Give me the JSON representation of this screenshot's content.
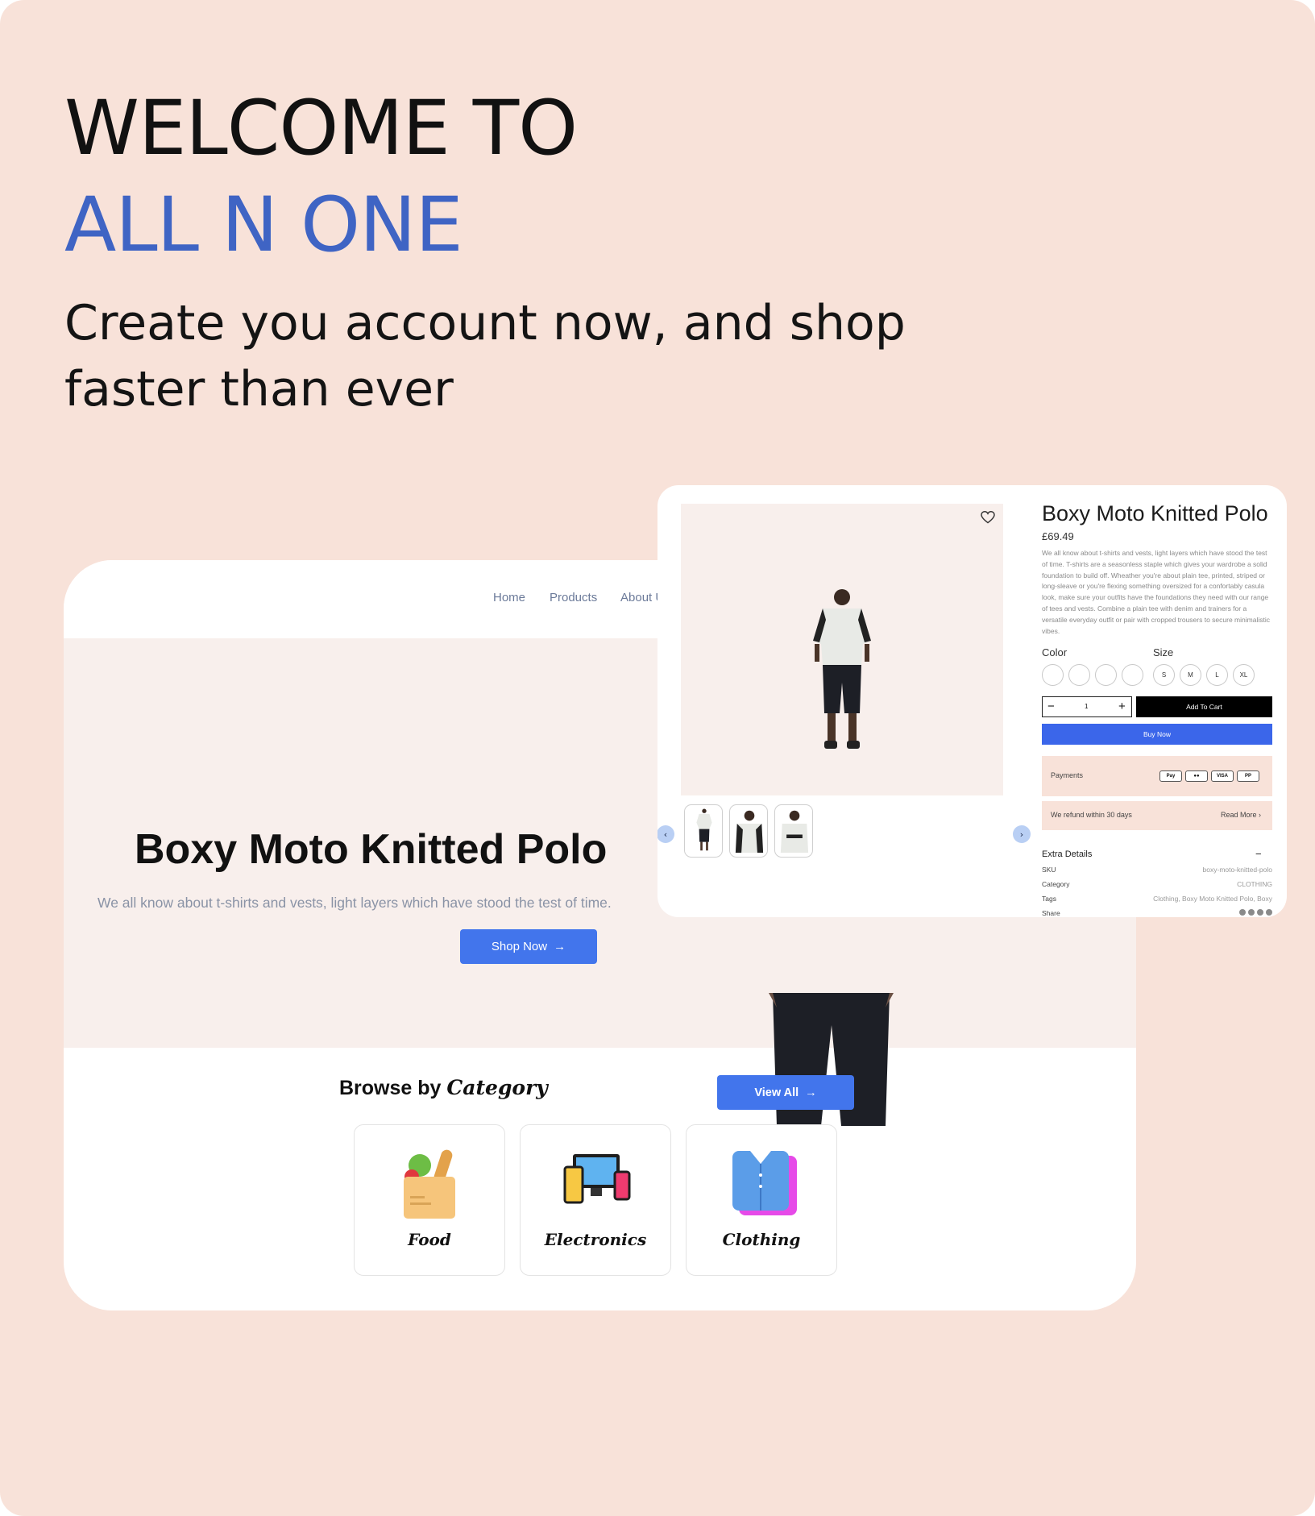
{
  "headline": {
    "line1": "WELCOME TO",
    "line2": "ALL N ONE",
    "tagline": "Create you account now, and shop faster than ever"
  },
  "home": {
    "nav": [
      "Home",
      "Products",
      "About U"
    ],
    "hero": {
      "title": "Boxy Moto Knitted Polo",
      "description": "We all know about t-shirts and vests, light layers which have stood the test of time.",
      "cta": "Shop Now"
    },
    "browse": {
      "title_plain": "Browse by",
      "title_accent": "Category",
      "view_all": "View All"
    },
    "categories": [
      {
        "label": "Food",
        "icon": "grocery-bag-icon"
      },
      {
        "label": "Electronics",
        "icon": "devices-icon"
      },
      {
        "label": "Clothing",
        "icon": "shirt-icon"
      }
    ]
  },
  "product": {
    "title": "Boxy Moto Knitted Polo",
    "price": "£69.49",
    "description": "We all know about t-shirts and vests, light layers which have stood the test of time. T-shirts are a seasonless staple which gives your wardrobe a solid foundation to build off. Wheather you're about plain tee, printed, striped or long-sleave or you're flexing something oversized for a confortably casula look, make sure your outfits have the foundations they need with our range of tees and vests. Combine a plain tee with denim and trainers for a versatile everyday outfit or pair with cropped trousers to secure minimalistic vibes.",
    "color_label": "Color",
    "size_label": "Size",
    "sizes": [
      "S",
      "M",
      "L",
      "XL"
    ],
    "quantity": "1",
    "add_to_cart": "Add To Cart",
    "buy_now": "Buy Now",
    "payments_label": "Payments",
    "payment_methods": [
      "Apple Pay",
      "Mastercard",
      "VISA",
      "PayPal"
    ],
    "refund_text": "We refund within 30 days",
    "read_more": "Read More",
    "extra_title": "Extra Details",
    "extra": {
      "sku_label": "SKU",
      "sku": "boxy-moto-knitted-polo",
      "category_label": "Category",
      "category": "CLOTHING",
      "tags_label": "Tags",
      "tags": "Clothing, Boxy Moto Knitted Polo, Boxy",
      "share_label": "Share"
    }
  },
  "colors": {
    "background": "#f8e2d9",
    "accent_blue": "#3f64c4",
    "button_blue": "#4275ec",
    "hero_bg": "#f8efec"
  }
}
